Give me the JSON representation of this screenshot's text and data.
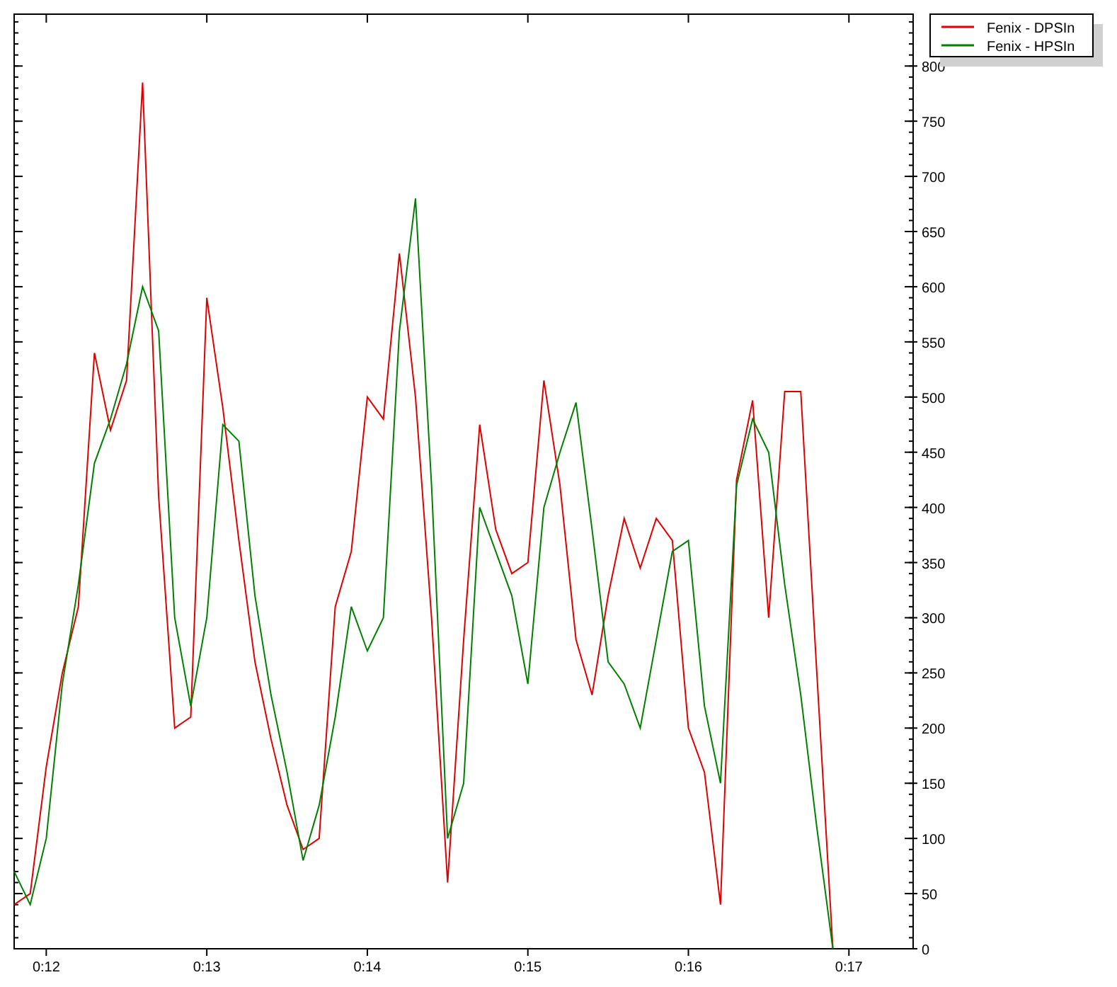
{
  "chart": {
    "chart_data": {
      "type": "line",
      "x": [
        11.8,
        11.9,
        12.0,
        12.1,
        12.2,
        12.3,
        12.4,
        12.5,
        12.6,
        12.7,
        12.8,
        12.9,
        13.0,
        13.1,
        13.2,
        13.3,
        13.4,
        13.5,
        13.6,
        13.7,
        13.8,
        13.9,
        14.0,
        14.1,
        14.2,
        14.3,
        14.4,
        14.5,
        14.6,
        14.7,
        14.8,
        14.9,
        15.0,
        15.1,
        15.2,
        15.3,
        15.4,
        15.5,
        15.6,
        15.7,
        15.8,
        15.9,
        16.0,
        16.1,
        16.2,
        16.3,
        16.4,
        16.5,
        16.6,
        16.7,
        16.8,
        16.9
      ],
      "series": [
        {
          "name": "Fenix - DPSIn",
          "color": "#e00000",
          "values": [
            40,
            50,
            165,
            250,
            310,
            540,
            470,
            515,
            785,
            410,
            200,
            210,
            590,
            490,
            370,
            260,
            190,
            130,
            90,
            100,
            310,
            360,
            500,
            480,
            630,
            500,
            300,
            60,
            280,
            475,
            380,
            340,
            350,
            515,
            420,
            280,
            230,
            320,
            390,
            345,
            390,
            370,
            200,
            160,
            40,
            425,
            497,
            300,
            505,
            505,
            250,
            0
          ]
        },
        {
          "name": "Fenix - HPSIn",
          "color": "#008000",
          "values": [
            70,
            40,
            100,
            240,
            330,
            440,
            480,
            530,
            600,
            560,
            300,
            220,
            300,
            475,
            460,
            320,
            230,
            160,
            80,
            130,
            210,
            310,
            270,
            300,
            560,
            680,
            420,
            100,
            150,
            400,
            360,
            320,
            240,
            400,
            450,
            495,
            380,
            260,
            240,
            200,
            280,
            360,
            370,
            220,
            150,
            420,
            480,
            450,
            330,
            230,
            110,
            0
          ]
        }
      ],
      "xlim": [
        11.8,
        17.4
      ],
      "ylim": [
        0,
        847
      ],
      "xticks": [
        {
          "value": 12,
          "label": "0:12"
        },
        {
          "value": 13,
          "label": "0:13"
        },
        {
          "value": 14,
          "label": "0:14"
        },
        {
          "value": 15,
          "label": "0:15"
        },
        {
          "value": 16,
          "label": "0:16"
        },
        {
          "value": 17,
          "label": "0:17"
        }
      ],
      "yticks": [
        0,
        50,
        100,
        150,
        200,
        250,
        300,
        350,
        400,
        450,
        500,
        550,
        600,
        650,
        700,
        750,
        800
      ],
      "legend": "upper right"
    }
  }
}
